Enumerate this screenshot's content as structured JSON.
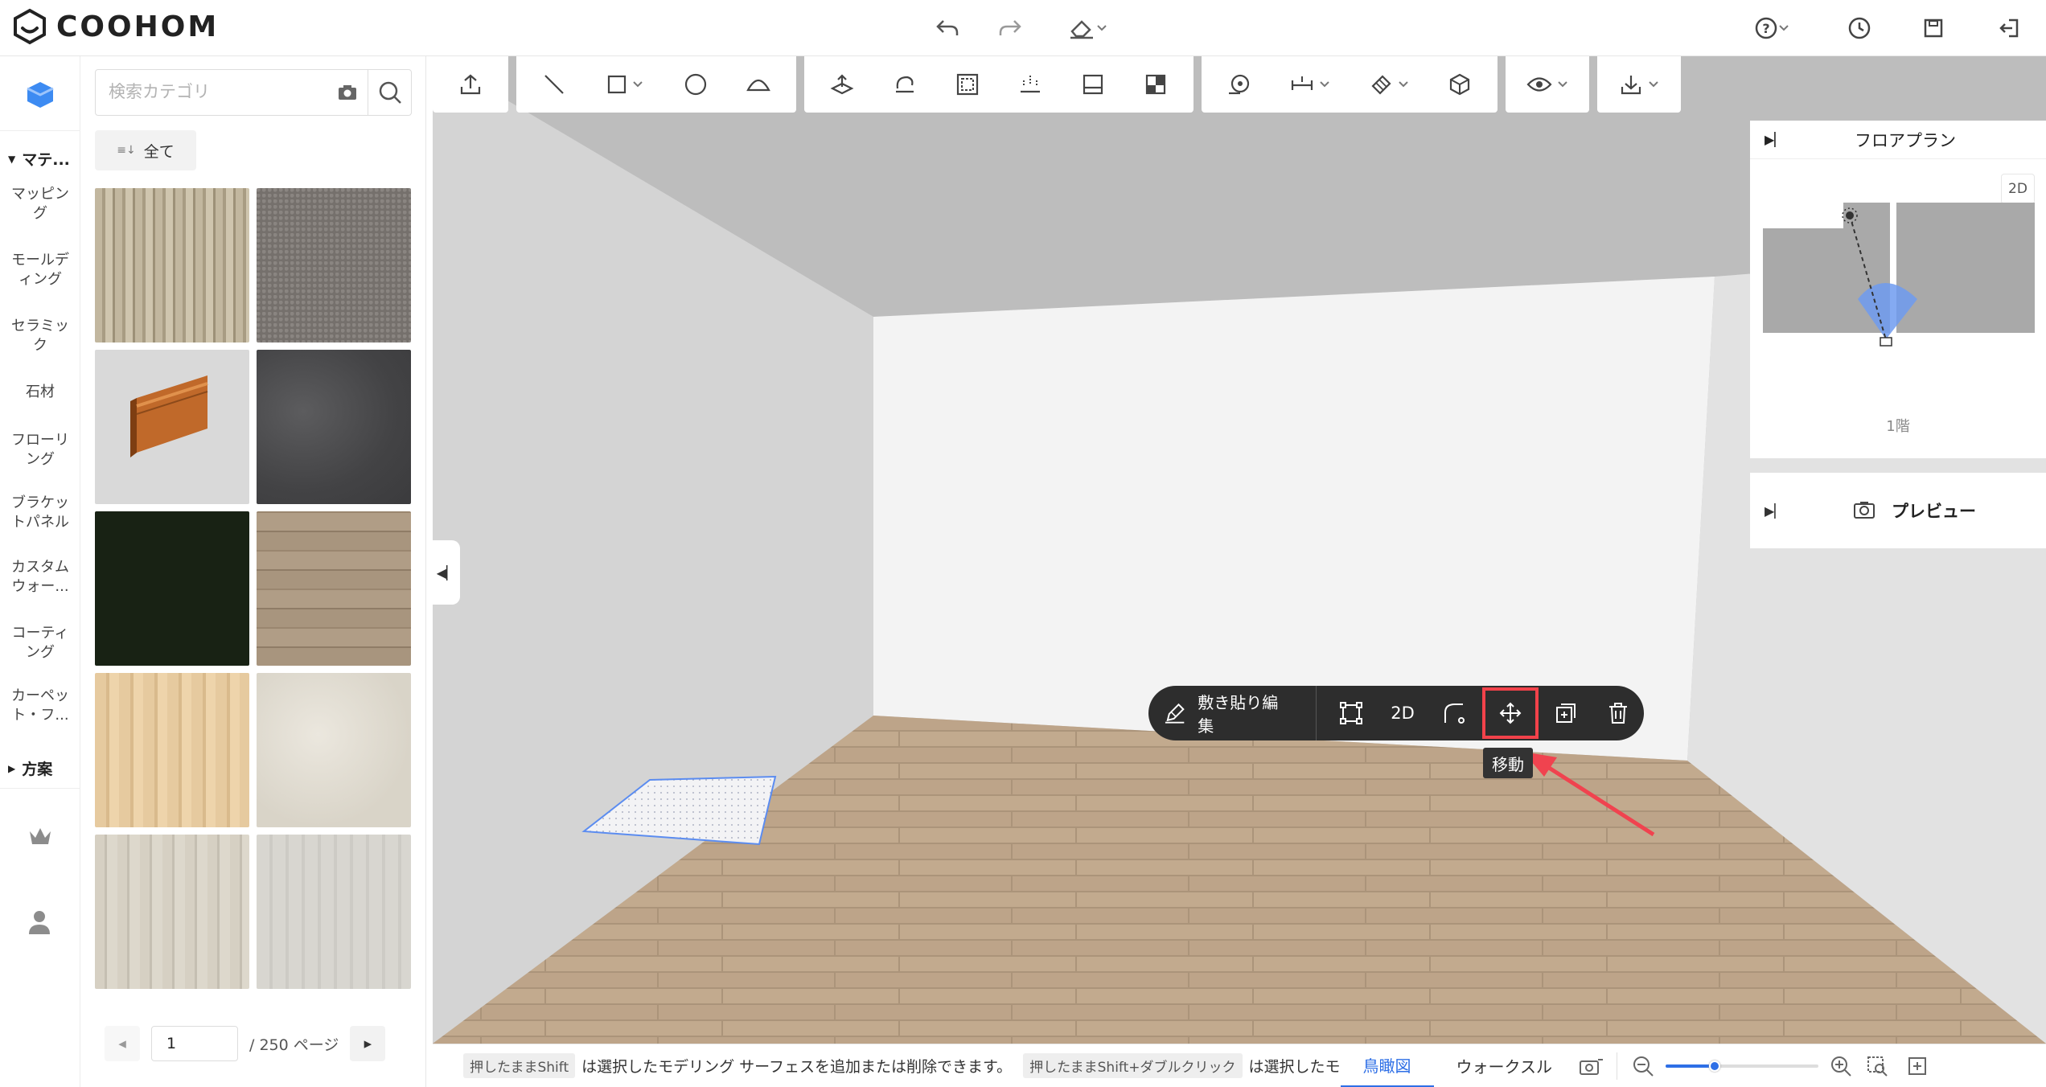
{
  "app": {
    "brand": "COOHOM"
  },
  "search": {
    "placeholder": "検索カテゴリ"
  },
  "filter": {
    "all_label": "全て"
  },
  "rail": {
    "section_materials": "マテ...",
    "items": [
      "マッピング",
      "モールディング",
      "セラミック",
      "石材",
      "フローリング",
      "ブラケットパネル",
      "カスタムウォー...",
      "コーティング",
      "カーペット・フ..."
    ],
    "section_plans": "方案"
  },
  "tiles": [
    {
      "color": "#b6ab94"
    },
    {
      "color": "#77726e"
    },
    {
      "color": "#d9d9d9"
    },
    {
      "color": "#4d4d4f"
    },
    {
      "color": "#1a2416"
    },
    {
      "color": "#a18f79"
    },
    {
      "color": "#e0c49a"
    },
    {
      "color": "#dedad0"
    },
    {
      "color": "#cfc9bd"
    },
    {
      "color": "#d4d2cc"
    }
  ],
  "pager": {
    "page": "1",
    "total": "/ 250 ページ"
  },
  "floating_toolbar": {
    "edit_label": "敷き貼り編集",
    "twod_label": "2D",
    "tooltip": "移動"
  },
  "floorplan": {
    "title": "フロアプラン",
    "mode": "2D",
    "floor": "1階"
  },
  "preview": {
    "title": "プレビュー"
  },
  "status": {
    "key1": "押したままShift",
    "text1": "は選択したモデリング サーフェスを追加または削除できます。",
    "key2": "押したままShift+ダブルクリック",
    "text2": "は選択したモ",
    "tab_birdseye": "鳥瞰図",
    "tab_walk": "ウォークスル"
  },
  "colors": {
    "accent": "#2e6fe6",
    "highlight": "#f2424a",
    "floor": "#b89d7f"
  }
}
